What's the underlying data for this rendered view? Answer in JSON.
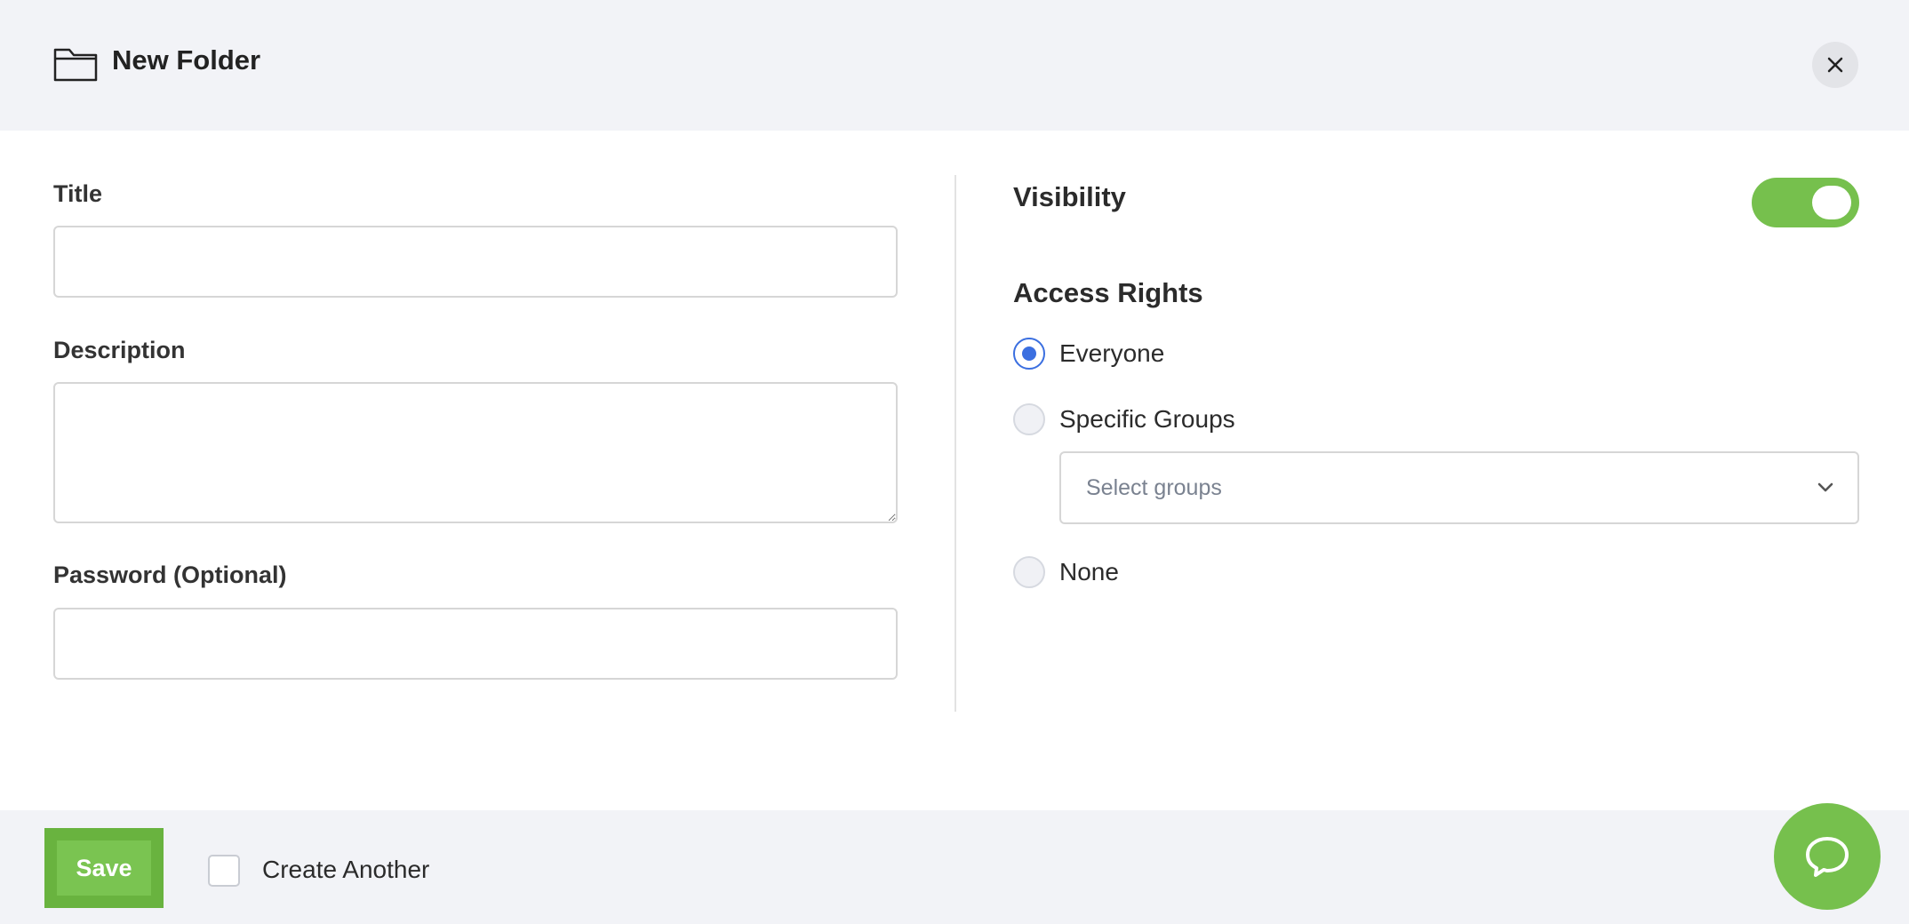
{
  "header": {
    "title": "New Folder",
    "icon": "folder-icon",
    "close_icon": "close-icon"
  },
  "form": {
    "title_label": "Title",
    "title_value": "",
    "description_label": "Description",
    "description_value": "",
    "password_label": "Password (Optional)",
    "password_value": ""
  },
  "visibility": {
    "label": "Visibility",
    "enabled": true
  },
  "access": {
    "title": "Access Rights",
    "options": [
      {
        "label": "Everyone",
        "checked": true
      },
      {
        "label": "Specific Groups",
        "checked": false
      },
      {
        "label": "None",
        "checked": false
      }
    ],
    "groups_placeholder": "Select groups"
  },
  "footer": {
    "save_label": "Save",
    "create_another_label": "Create Another",
    "create_another_checked": false,
    "chat_icon": "chat-bubble-icon"
  },
  "colors": {
    "accent_green": "#76c04d",
    "radio_blue": "#3b6fe0",
    "header_bg": "#f2f3f7"
  }
}
